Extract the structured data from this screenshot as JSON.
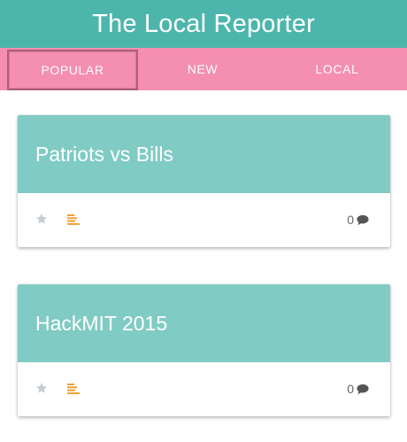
{
  "app": {
    "title": "The Local Reporter"
  },
  "tabs": [
    {
      "label": "POPULAR",
      "active": true
    },
    {
      "label": "NEW",
      "active": false
    },
    {
      "label": "LOCAL",
      "active": false
    }
  ],
  "articles": [
    {
      "title": "Patriots vs Bills",
      "comment_count": "0",
      "icons": [
        "star-icon",
        "article-lines-icon",
        "comment-icon"
      ]
    },
    {
      "title": "HackMIT 2015",
      "comment_count": "0",
      "icons": [
        "star-icon",
        "article-lines-icon",
        "comment-icon"
      ]
    }
  ],
  "colors": {
    "app_bar": "#4db6ac",
    "tabs_bar": "#f48fb1",
    "card_header": "#80cbc4",
    "star": "#c5ccd3",
    "article_icon": "#f0a030",
    "comment_icon": "#555555"
  }
}
